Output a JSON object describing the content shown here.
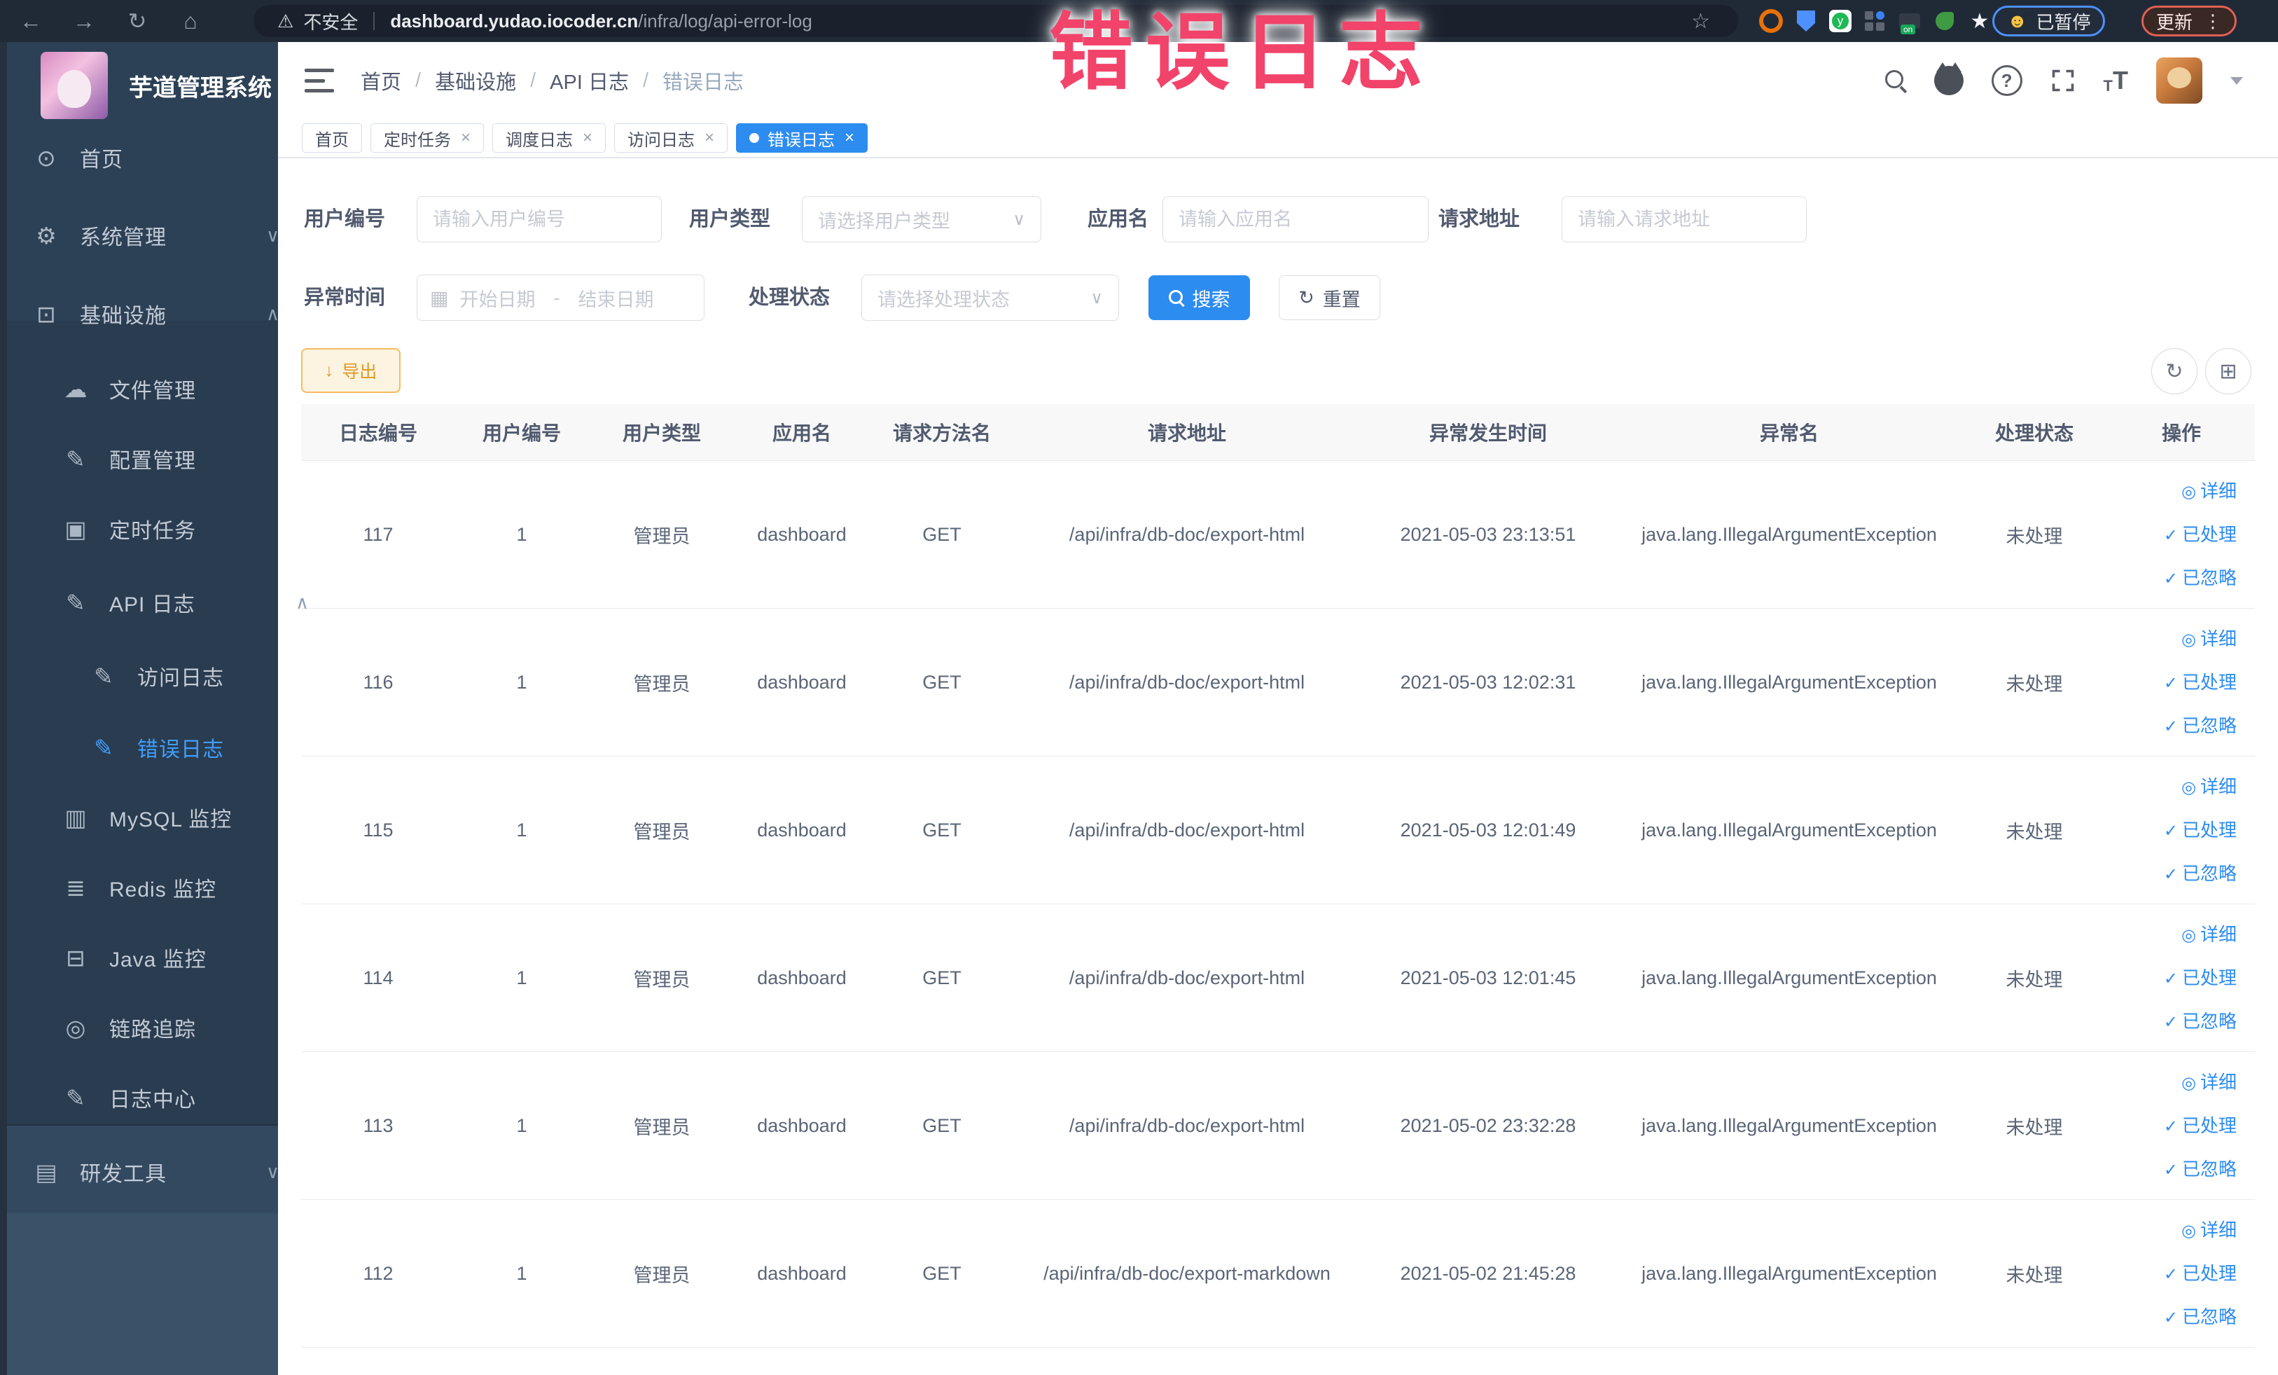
{
  "colors": {
    "accent": "#2d8cf0",
    "sidebar_bg": "#2d4156",
    "sidebar_active": "#3f9eff",
    "overlay_pink": "#f2436a",
    "export_orange": "#dd9927",
    "chrome_bg": "#202a37",
    "table_header_bg": "#f8f8f9"
  },
  "overlay": {
    "title": "错误日志"
  },
  "browser": {
    "icons": {
      "back": "←",
      "forward": "→",
      "reload": "↻",
      "home": "⌂",
      "warning": "⚠",
      "star": "☆",
      "dots": "⋮",
      "smiley": "☻"
    },
    "security_label": "不安全",
    "url_domain": "dashboard.yudao.iocoder.cn",
    "url_path": "/infra/log/api-error-log",
    "extension_y_glyph": "y",
    "extension_on_glyph": "on",
    "extension_star_glyph": "★",
    "paused_chip": "已暂停",
    "update_chip": "更新"
  },
  "sidebar": {
    "title": "芋道管理系统",
    "items": [
      {
        "icon": "dashboard-icon",
        "glyph": "⊙",
        "label": "首页"
      },
      {
        "icon": "gear-icon",
        "glyph": "⚙",
        "label": "系统管理",
        "chevron": "∨"
      },
      {
        "icon": "infrastructure-icon",
        "glyph": "⊡",
        "label": "基础设施",
        "chevron": "∧"
      },
      {
        "icon": "cloud-icon",
        "glyph": "☁",
        "label": "文件管理"
      },
      {
        "icon": "edit-icon",
        "glyph": "✎",
        "label": "配置管理"
      },
      {
        "icon": "task-icon",
        "glyph": "▣",
        "label": "定时任务"
      },
      {
        "icon": "log-icon",
        "glyph": "✎",
        "label": "API 日志",
        "chevron": "∧"
      },
      {
        "icon": "log-icon",
        "glyph": "✎",
        "label": "访问日志"
      },
      {
        "icon": "log-icon",
        "glyph": "✎",
        "label": "错误日志"
      },
      {
        "icon": "mysql-icon",
        "glyph": "▥",
        "label": "MySQL 监控"
      },
      {
        "icon": "redis-icon",
        "glyph": "≣",
        "label": "Redis 监控"
      },
      {
        "icon": "java-icon",
        "glyph": "⊟",
        "label": "Java 监控"
      },
      {
        "icon": "trace-icon",
        "glyph": "◎",
        "label": "链路追踪"
      },
      {
        "icon": "log-center-icon",
        "glyph": "✎",
        "label": "日志中心"
      },
      {
        "icon": "tools-icon",
        "glyph": "▤",
        "label": "研发工具",
        "chevron": "∨"
      }
    ]
  },
  "header": {
    "breadcrumb": [
      "首页",
      "基础设施",
      "API 日志",
      "错误日志"
    ],
    "separator": "/",
    "help_glyph": "?",
    "font_icon_glyph": "T"
  },
  "tabs": {
    "close_glyph": "×",
    "items": [
      {
        "label": "首页",
        "closable": false,
        "active": false
      },
      {
        "label": "定时任务",
        "closable": true,
        "active": false
      },
      {
        "label": "调度日志",
        "closable": true,
        "active": false
      },
      {
        "label": "访问日志",
        "closable": true,
        "active": false
      },
      {
        "label": "错误日志",
        "closable": true,
        "active": true
      }
    ]
  },
  "filters": {
    "user_id": {
      "label": "用户编号",
      "placeholder": "请输入用户编号"
    },
    "user_type": {
      "label": "用户类型",
      "placeholder": "请选择用户类型"
    },
    "app_name": {
      "label": "应用名",
      "placeholder": "请输入应用名"
    },
    "request_url": {
      "label": "请求地址",
      "placeholder": "请输入请求地址"
    },
    "exception_time": {
      "label": "异常时间",
      "start_placeholder": "开始日期",
      "separator": "-",
      "end_placeholder": "结束日期",
      "calendar_glyph": "▦"
    },
    "process_status": {
      "label": "处理状态",
      "placeholder": "请选择处理状态"
    },
    "chevron_glyph": "∨",
    "search_button": "搜索",
    "reset_button": "重置",
    "reset_glyph": "↻"
  },
  "toolbar": {
    "export_button": "导出",
    "export_glyph": "↓",
    "refresh_glyph": "↻",
    "columns_glyph": "⊞"
  },
  "table": {
    "columns": [
      "日志编号",
      "用户编号",
      "用户类型",
      "应用名",
      "请求方法名",
      "请求地址",
      "异常发生时间",
      "异常名",
      "处理状态",
      "操作"
    ],
    "row_actions": [
      {
        "icon": "eye-icon",
        "glyph": "◎",
        "label": "详细"
      },
      {
        "icon": "check-icon",
        "glyph": "✓",
        "label": "已处理"
      },
      {
        "icon": "check-icon",
        "glyph": "✓",
        "label": "已忽略"
      }
    ],
    "rows": [
      {
        "id": "117",
        "user_id": "1",
        "user_type": "管理员",
        "app": "dashboard",
        "method": "GET",
        "url": "/api/infra/db-doc/export-html",
        "time": "2021-05-03 23:13:51",
        "exception": "java.lang.IllegalArgumentException",
        "status": "未处理"
      },
      {
        "id": "116",
        "user_id": "1",
        "user_type": "管理员",
        "app": "dashboard",
        "method": "GET",
        "url": "/api/infra/db-doc/export-html",
        "time": "2021-05-03 12:02:31",
        "exception": "java.lang.IllegalArgumentException",
        "status": "未处理"
      },
      {
        "id": "115",
        "user_id": "1",
        "user_type": "管理员",
        "app": "dashboard",
        "method": "GET",
        "url": "/api/infra/db-doc/export-html",
        "time": "2021-05-03 12:01:49",
        "exception": "java.lang.IllegalArgumentException",
        "status": "未处理"
      },
      {
        "id": "114",
        "user_id": "1",
        "user_type": "管理员",
        "app": "dashboard",
        "method": "GET",
        "url": "/api/infra/db-doc/export-html",
        "time": "2021-05-03 12:01:45",
        "exception": "java.lang.IllegalArgumentException",
        "status": "未处理"
      },
      {
        "id": "113",
        "user_id": "1",
        "user_type": "管理员",
        "app": "dashboard",
        "method": "GET",
        "url": "/api/infra/db-doc/export-html",
        "time": "2021-05-02 23:32:28",
        "exception": "java.lang.IllegalArgumentException",
        "status": "未处理"
      },
      {
        "id": "112",
        "user_id": "1",
        "user_type": "管理员",
        "app": "dashboard",
        "method": "GET",
        "url": "/api/infra/db-doc/export-markdown",
        "time": "2021-05-02 21:45:28",
        "exception": "java.lang.IllegalArgumentException",
        "status": "未处理"
      }
    ]
  }
}
